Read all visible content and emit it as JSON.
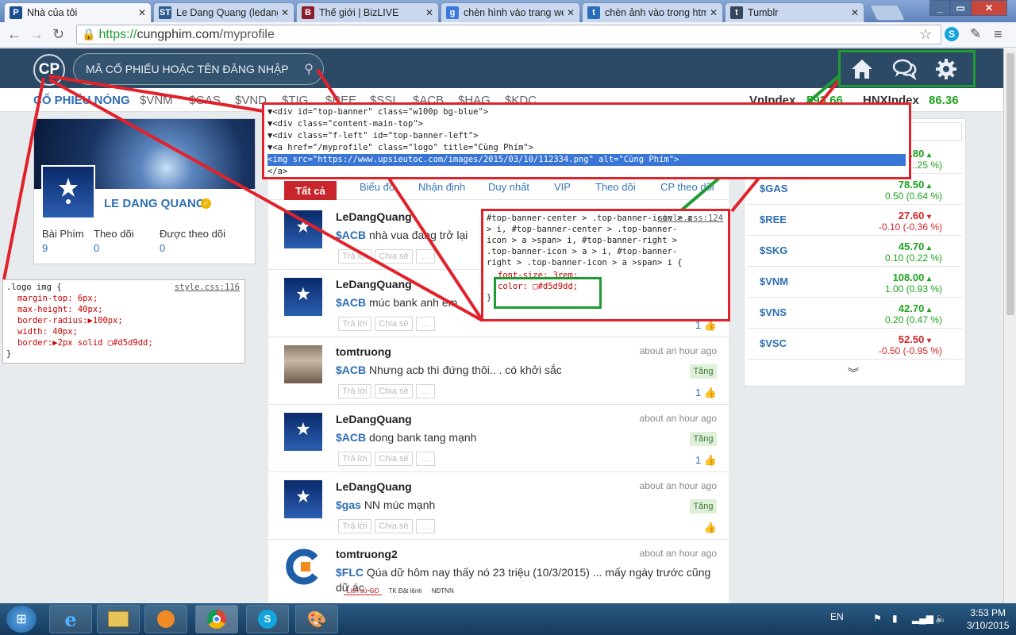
{
  "browser": {
    "tabs": [
      {
        "title": "Nhà của tôi",
        "favicon": "P",
        "fav_color": "#1c4f91",
        "active": true
      },
      {
        "title": "Le Dang Quang (ledang",
        "favicon": "ST",
        "fav_color": "#2b5c8e",
        "active": false
      },
      {
        "title": "Thế giới | BizLIVE",
        "favicon": "B",
        "fav_color": "#8b1c2c",
        "active": false
      },
      {
        "title": "chèn hình vào trang we",
        "favicon": "g",
        "fav_color": "#3b7ae0",
        "active": false
      },
      {
        "title": "chèn ảnh vào trong htm",
        "favicon": "t",
        "fav_color": "#2b6cb8",
        "active": false
      },
      {
        "title": "Tumblr",
        "favicon": "t",
        "fav_color": "#36465d",
        "active": false
      }
    ],
    "url_https": "https://",
    "url_host": "cungphim.com",
    "url_path": "/myprofile"
  },
  "header": {
    "logo_text": "CP",
    "search_placeholder": "MÃ CỔ PHIẾU HOẶC TÊN ĐĂNG NHẬP",
    "icons": [
      "home-icon",
      "chat-icon",
      "gear-icon"
    ]
  },
  "ticker": {
    "label": "CỔ PHIẾU NÓNG",
    "symbols": [
      "$VNM",
      "$GAS",
      "$VND",
      "$TIG",
      "$REE",
      "$SSI",
      "$ACB",
      "$HAG",
      "$KDC"
    ],
    "vnindex_label": "VnIndex",
    "vnindex_value": "593.66",
    "hnxindex_label": "HNXIndex",
    "hnxindex_value": "86.36"
  },
  "profile": {
    "name": "LE DANG QUANG",
    "stats": [
      {
        "label": "Bài Phím",
        "value": "9"
      },
      {
        "label": "Theo dõi",
        "value": "0"
      },
      {
        "label": "Được theo dõi",
        "value": "0"
      }
    ]
  },
  "feed": {
    "tabs": [
      "Tất cả",
      "Biểu đồ",
      "Nhận định",
      "Duy nhất",
      "VIP",
      "Theo dõi",
      "CP theo dõi"
    ],
    "reply_label": "Trả lời",
    "share_label": "Chia sẻ",
    "more_label": "...",
    "posts": [
      {
        "user": "LeDangQuang",
        "time": "",
        "symbol": "$ACB",
        "text": "nhà vua đang trở lại",
        "tag": "",
        "likes": ""
      },
      {
        "user": "LeDangQuang",
        "time": "",
        "symbol": "$ACB",
        "text": "múc bank anh em",
        "tag": "",
        "likes": "1"
      },
      {
        "user": "tomtruong",
        "time": "about an hour ago",
        "symbol": "$ACB",
        "text": "Nhưng acb thì đứng thôi.. . có khởi sắc",
        "tag": "Tăng",
        "likes": "1"
      },
      {
        "user": "LeDangQuang",
        "time": "about an hour ago",
        "symbol": "$ACB",
        "text": "dong bank tang mạnh",
        "tag": "Tăng",
        "likes": "1"
      },
      {
        "user": "LeDangQuang",
        "time": "about an hour ago",
        "symbol": "$gas",
        "text": "NN múc mạnh",
        "tag": "Tăng",
        "likes": ""
      },
      {
        "user": "tomtruong2",
        "time": "about an hour ago",
        "symbol": "$FLC",
        "text": "Qúa dữ hôm nay thấy nó 23 triệu (10/3/2015) ... mấy ngày trước cũng dữ ác ...",
        "tag": "",
        "likes": ""
      }
    ],
    "attachment_tabs": [
      "Lịch sử GD",
      "TK Đặt lệnh",
      "NĐTNN"
    ]
  },
  "watchlist": [
    {
      "symbol": "",
      "price": "...80",
      "change": "...25 %)",
      "dir": "up"
    },
    {
      "symbol": "$GAS",
      "price": "78.50",
      "change": "0.50 (0.64 %)",
      "dir": "up"
    },
    {
      "symbol": "$REE",
      "price": "27.60",
      "change": "-0.10 (-0.36 %)",
      "dir": "down"
    },
    {
      "symbol": "$SKG",
      "price": "45.70",
      "change": "0.10 (0.22 %)",
      "dir": "up"
    },
    {
      "symbol": "$VNM",
      "price": "108.00",
      "change": "1.00 (0.93 %)",
      "dir": "up"
    },
    {
      "symbol": "$VNS",
      "price": "42.70",
      "change": "0.20 (0.47 %)",
      "dir": "up"
    },
    {
      "symbol": "$VSC",
      "price": "52.50",
      "change": "-0.50 (-0.95 %)",
      "dir": "down"
    }
  ],
  "devtools": {
    "dom_lines": [
      "▼<div id=\"top-banner\" class=\"w100p bg-blue\">",
      "  ▼<div class=\"content-main-top\">",
      "    ▼<div class=\"f-left\" id=\"top-banner-left\">",
      "      ▼<a href=\"/myprofile\" class=\"logo\" title=\"Cùng Phím\">",
      "          <img src=\"https://www.upsieutoc.com/images/2015/03/10/112334.png\" alt=\"Cùng Phím\">",
      "        </a>"
    ],
    "css_right_selector": "#top-banner-center > .top-banner-icon > a > i, #top-banner-center > .top-banner-icon > a >span> i, #top-banner-right > .top-banner-icon > a > i, #top-banner-right > .top-banner-icon > a >span> i {",
    "css_right_source": "style.css:124",
    "css_right_props": [
      "font-size: 3rem;",
      "color: ▢#d5d9dd;"
    ],
    "css_left_selector": ".logo img {",
    "css_left_source": "style.css:116",
    "css_left_props": [
      "margin-top: 6px;",
      "max-height: 40px;",
      "border-radius:▶100px;",
      "width: 40px;",
      "border:▶2px solid ▢#d5d9dd;"
    ],
    "close_brace": "}"
  },
  "taskbar": {
    "lang": "EN",
    "time": "3:53 PM",
    "date": "3/10/2015"
  },
  "colors": {
    "accent": "#2c4a66",
    "highlight_red": "#e1222a",
    "highlight_green": "#1e9c33",
    "up": "#1ea31e",
    "down": "#d3262a"
  }
}
